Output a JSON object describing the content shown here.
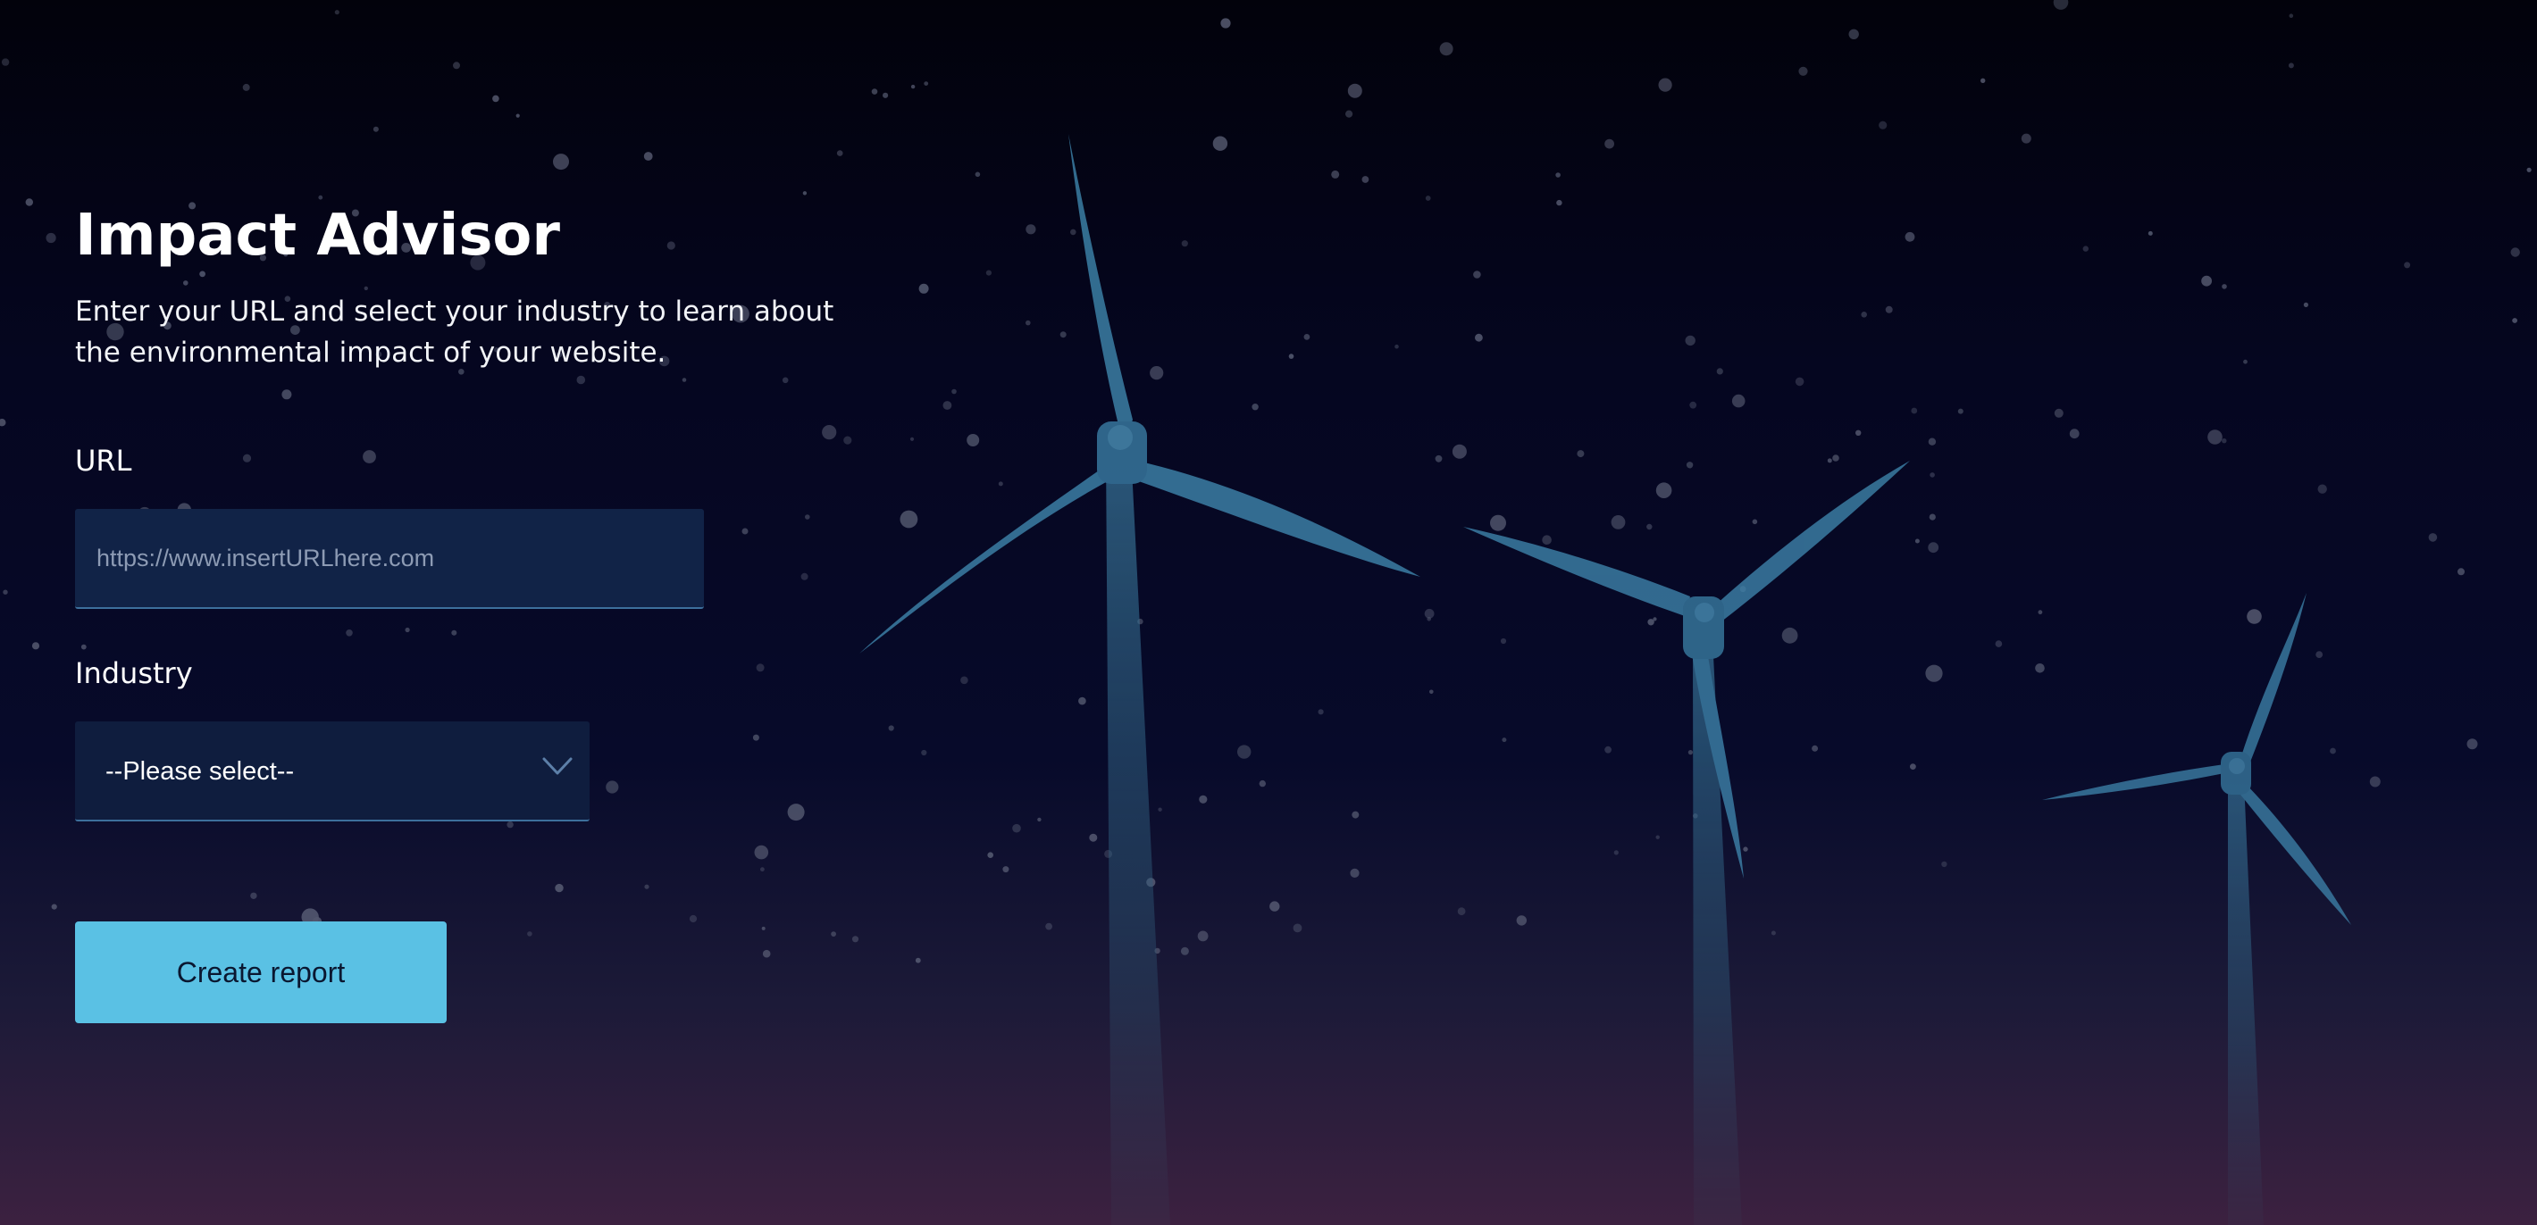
{
  "page": {
    "title": "Impact Advisor",
    "subtitle": "Enter your URL and select your industry to learn about the environmental impact of your website."
  },
  "form": {
    "url_label": "URL",
    "url_placeholder": "https://www.insertURLhere.com",
    "url_value": "",
    "industry_label": "Industry",
    "industry_selected": "--Please select--",
    "submit_label": "Create report"
  },
  "icons": {
    "select_arrow": "chevron-down-icon"
  },
  "colors": {
    "button": "#5ac1e4",
    "input_bg": "#112347",
    "turbine": "#3f86ad"
  }
}
